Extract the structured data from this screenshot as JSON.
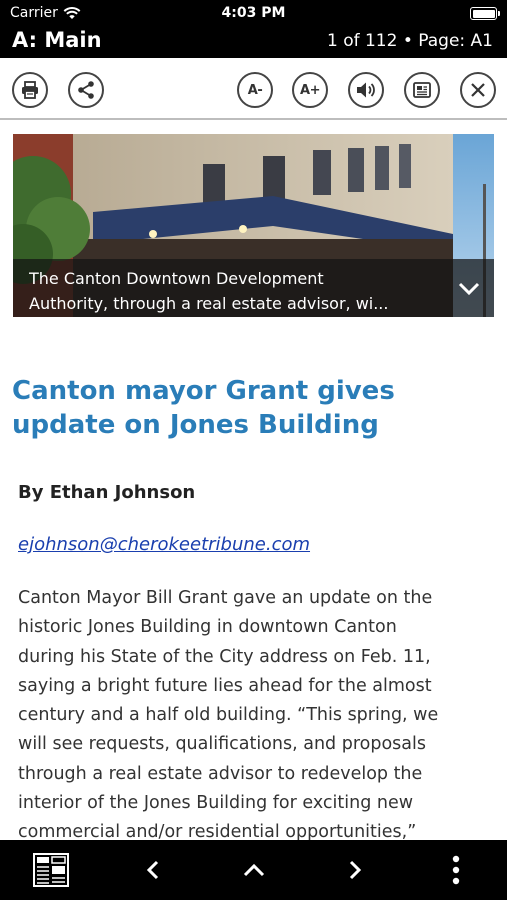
{
  "status_bar": {
    "carrier": "Carrier",
    "time": "4:03 PM",
    "icons": [
      "wifi-icon",
      "battery-icon"
    ]
  },
  "title_bar": {
    "section": "A: Main",
    "page_info": "1 of 112 • Page: A1"
  },
  "toolbar": {
    "buttons": [
      "print-icon",
      "share-icon",
      "decrease-font-button",
      "increase-font-button",
      "speaker-icon",
      "article-view-icon",
      "close-icon"
    ],
    "font_decrease_label": "A-",
    "font_increase_label": "A+"
  },
  "photo": {
    "caption_line1": "The Canton Downtown Development",
    "caption_line2": "Authority, through a real estate advisor, wi...",
    "expand_icon": "chevron-down-icon"
  },
  "article": {
    "headline": "Canton mayor Grant gives update on Jones Building",
    "byline": "By Ethan Johnson",
    "email": "ejohnson@cherokeetribune.com",
    "body_lines": [
      "Canton Mayor Bill Grant gave an update on the",
      "historic Jones Building in downtown Canton",
      "during his State of the City address on Feb. 11,",
      "saying a bright future lies ahead for the almost",
      "century and a half old building. “This spring, we",
      "will see requests, qualifications, and proposals",
      "through a real estate advisor to redevelop the",
      "interior of the Jones Building for exciting new",
      "commercial and/or residential opportunities,”"
    ]
  },
  "bottom_nav": {
    "buttons": [
      "pages-grid-icon",
      "previous-chevron-icon",
      "up-chevron-icon",
      "next-chevron-icon",
      "more-options-icon"
    ]
  },
  "colors": {
    "headline": "#2a7db8",
    "link": "#1a3fae",
    "bars": "#000000"
  }
}
